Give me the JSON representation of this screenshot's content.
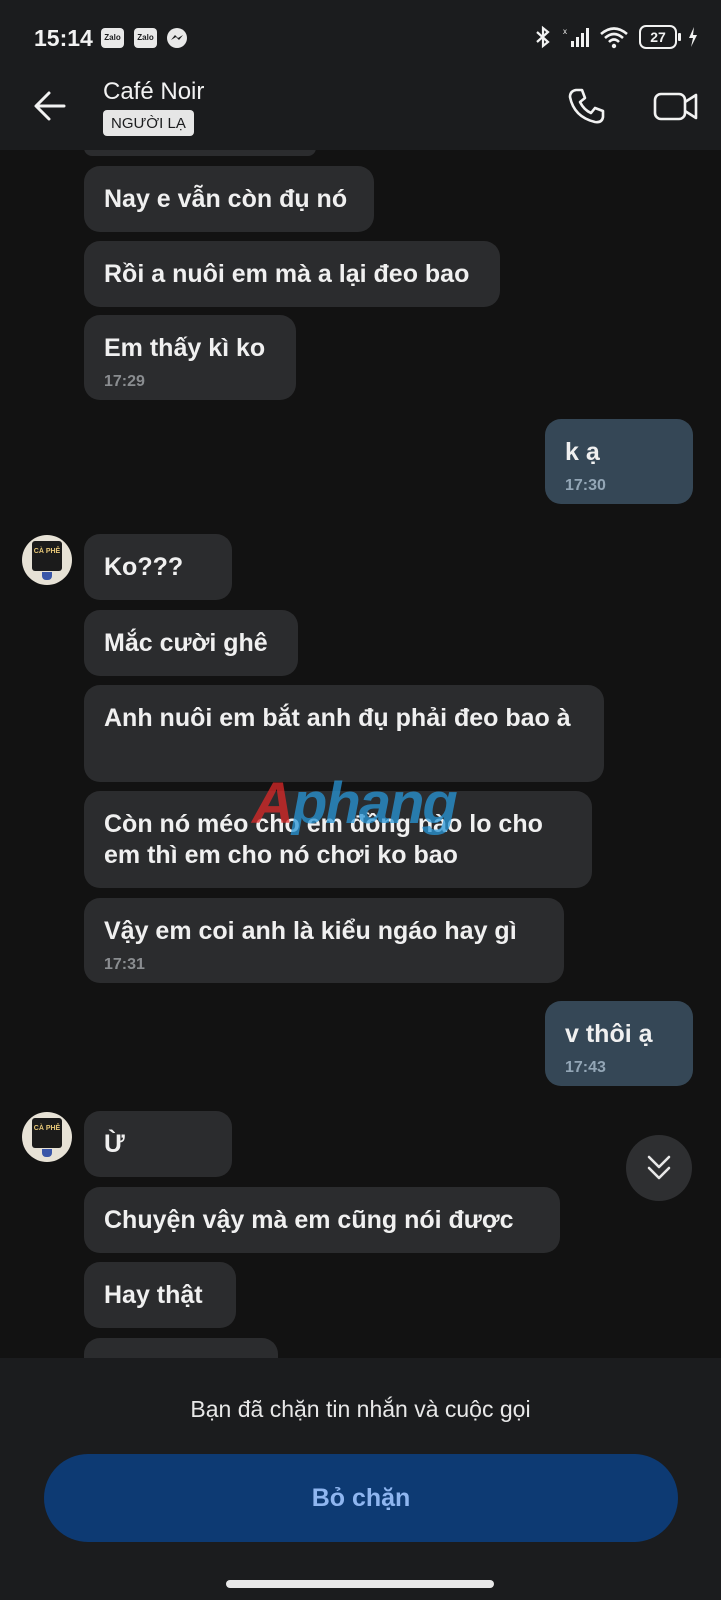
{
  "status_bar": {
    "time": "15:14",
    "app_icons": [
      "Zalo",
      "Zalo"
    ],
    "messenger_icon": "messenger-icon",
    "battery": "27"
  },
  "header": {
    "title": "Café Noir",
    "badge": "NGƯỜI LẠ"
  },
  "messages": [
    {
      "side": "in",
      "text": "Nay e vẫn còn đụ nó"
    },
    {
      "side": "in",
      "text": "Rồi a nuôi em mà a lại đeo bao"
    },
    {
      "side": "in",
      "text": "Em thấy kì ko",
      "time": "17:29"
    },
    {
      "side": "out",
      "text": "k ạ",
      "time": "17:30"
    },
    {
      "side": "in",
      "text": "Ko???"
    },
    {
      "side": "in",
      "text": "Mắc cười ghê"
    },
    {
      "side": "in",
      "text": "Anh nuôi em bắt anh đụ phải đeo bao à"
    },
    {
      "side": "in",
      "text": "Còn nó méo cho em đồng nào lo cho em thì em cho nó chơi ko bao"
    },
    {
      "side": "in",
      "text": "Vậy em coi anh là kiểu ngáo hay gì",
      "time": "17:31"
    },
    {
      "side": "out",
      "text": "v thôi ạ",
      "time": "17:43"
    },
    {
      "side": "in",
      "text": "Ừ"
    },
    {
      "side": "in",
      "text": "Chuyện vậy mà em cũng nói được"
    },
    {
      "side": "in",
      "text": "Hay thật"
    }
  ],
  "avatar_text": "CÀ PHÊ",
  "watermark": {
    "first": "A",
    "rest": "phang"
  },
  "bottom": {
    "blocked_text": "Bạn đã chặn tin nhắn và cuộc gọi",
    "unblock_label": "Bỏ chặn"
  }
}
